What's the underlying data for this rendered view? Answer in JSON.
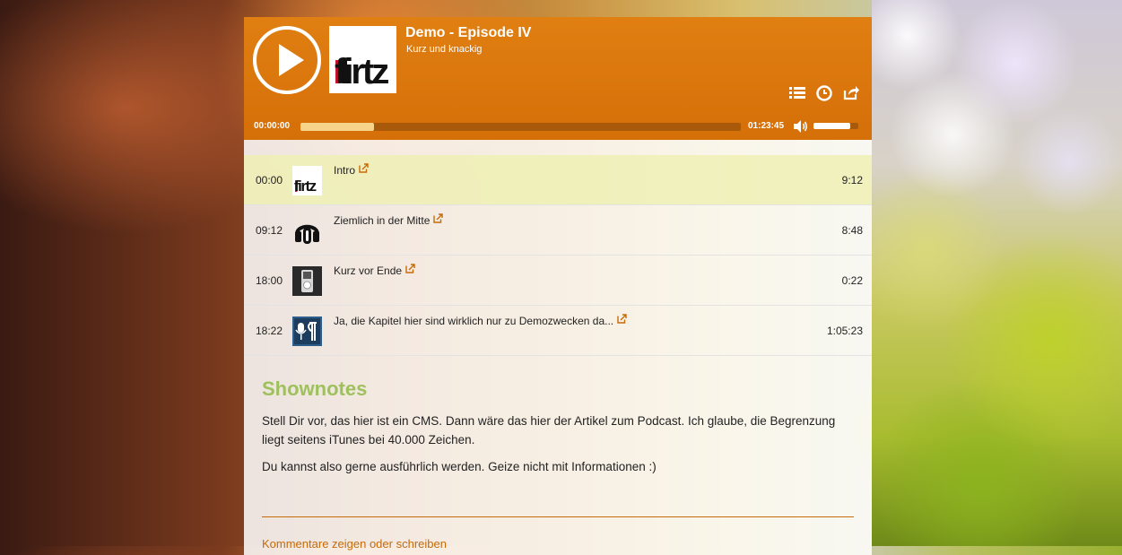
{
  "episode": {
    "title": "Demo - Episode IV",
    "subtitle": "Kurz und knackig",
    "cover_text": "fi rtz"
  },
  "playback": {
    "current_time": "00:00:00",
    "total_time": "01:23:45",
    "progress_fraction": 0.168,
    "volume_fraction": 0.82
  },
  "header_icons": [
    "chapters-list-icon",
    "clock-icon",
    "share-icon"
  ],
  "chapters": [
    {
      "start": "00:00",
      "title": "Intro",
      "duration": "9:12",
      "thumb": "firtz-logo",
      "active": true
    },
    {
      "start": "09:12",
      "title": "Ziemlich in der Mitte",
      "duration": "8:48",
      "thumb": "headphones-icon",
      "active": false
    },
    {
      "start": "18:00",
      "title": "Kurz vor Ende",
      "duration": "0:22",
      "thumb": "ipod-icon",
      "active": false
    },
    {
      "start": "18:22",
      "title": "Ja, die Kapitel hier sind wirklich nur zu Demozwecken da...",
      "duration": "1:05:23",
      "thumb": "podcast-mic-icon",
      "active": false
    }
  ],
  "shownotes": {
    "heading": "Shownotes",
    "paragraphs": [
      "Stell Dir vor, das hier ist ein CMS. Dann wäre das hier der Artikel zum Podcast. Ich glaube, die Begrenzung liegt seitens iTunes bei 40.000 Zeichen.",
      "Du kannst also gerne ausführlich werden. Geize nicht mit Informationen :)"
    ]
  },
  "comments_link": "Kommentare zeigen oder schreiben",
  "colors": {
    "header": "#d9740b",
    "accent": "#c56b0a",
    "shownotes_heading": "#9ec15c",
    "active_chapter": "#eef0b4"
  }
}
